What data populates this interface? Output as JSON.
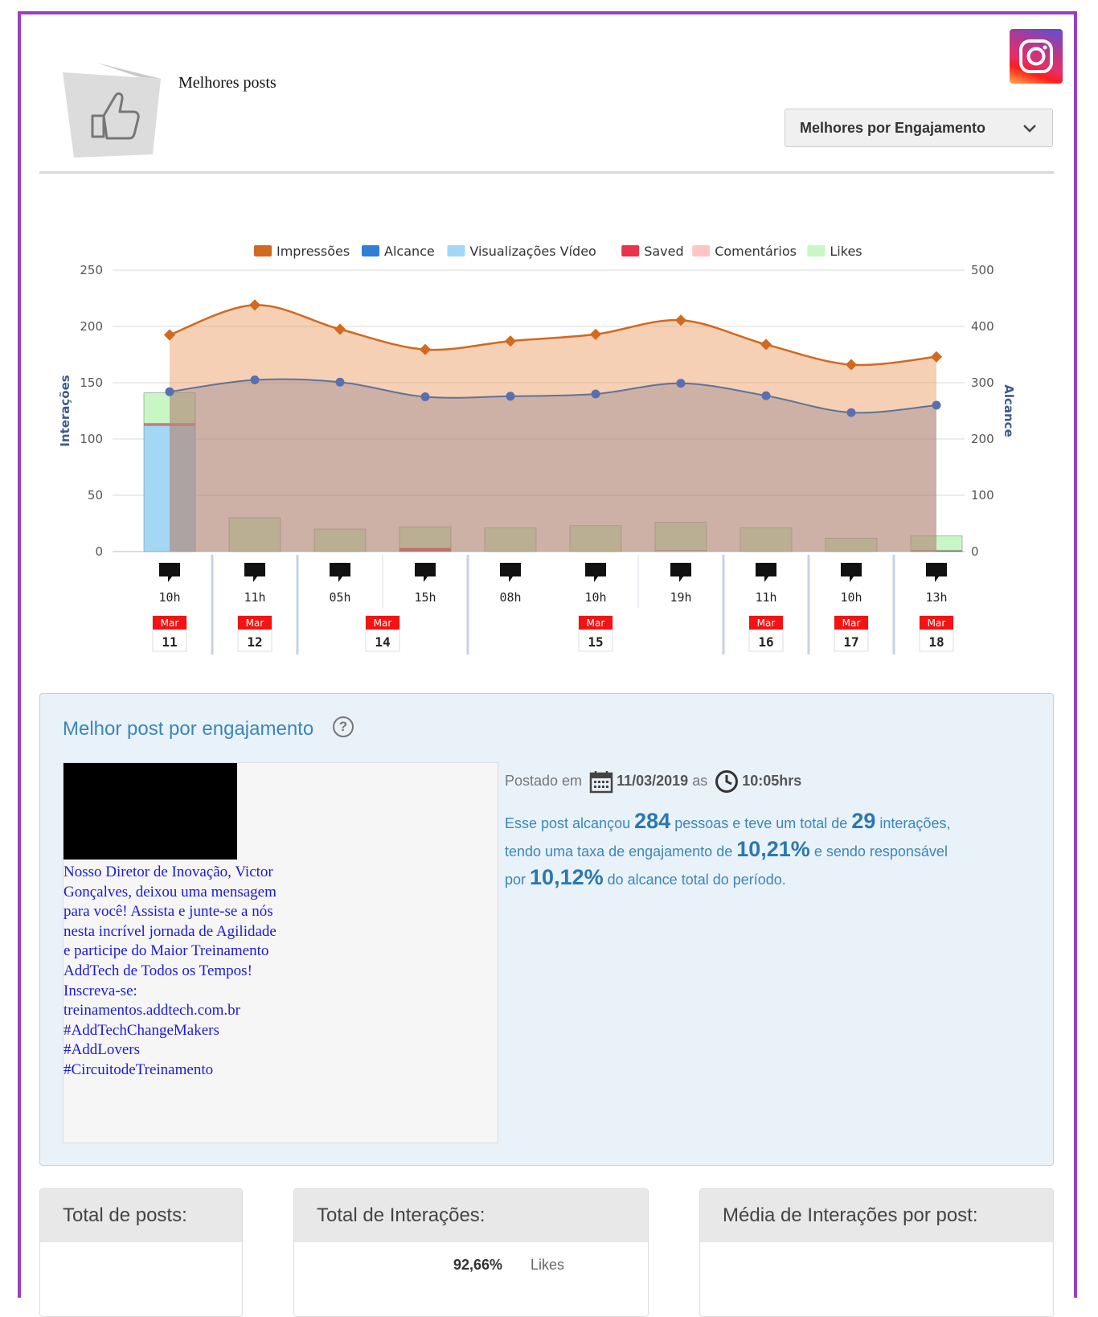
{
  "header": {
    "title": "Melhores posts"
  },
  "dropdown": {
    "selected": "Melhores por Engajamento"
  },
  "chart_data": {
    "type": "bar",
    "legend": [
      {
        "name": "Impressões",
        "color": "#d2691e"
      },
      {
        "name": "Alcance",
        "color": "#2f7ed8"
      },
      {
        "name": "Visualizações Vídeo",
        "color": "#a3d8f4"
      },
      {
        "name": "Saved",
        "color": "#e8334a"
      },
      {
        "name": "Comentários",
        "color": "#ffc5c5"
      },
      {
        "name": "Likes",
        "color": "#c8f7c5"
      }
    ],
    "y_left": {
      "label": "Interações",
      "ticks": [
        "0",
        "50",
        "100",
        "150",
        "200",
        "250"
      ],
      "ylim": [
        0,
        250
      ]
    },
    "y_right": {
      "label": "Alcance",
      "ticks": [
        "0",
        "100",
        "200",
        "300",
        "400",
        "500"
      ],
      "ylim": [
        0,
        500
      ]
    },
    "x_time_labels": [
      "10h",
      "11h",
      "05h",
      "15h",
      "08h",
      "10h",
      "19h",
      "11h",
      "10h",
      "13h"
    ],
    "date_badges": [
      {
        "month": "Mar",
        "day": "11",
        "slot": 0
      },
      {
        "month": "Mar",
        "day": "12",
        "slot": 1
      },
      {
        "month": "Mar",
        "day": "14",
        "slot": 2.5
      },
      {
        "month": "Mar",
        "day": "15",
        "slot": 5
      },
      {
        "month": "Mar",
        "day": "16",
        "slot": 7
      },
      {
        "month": "Mar",
        "day": "17",
        "slot": 8
      },
      {
        "month": "Mar",
        "day": "18",
        "slot": 9
      }
    ],
    "series": [
      {
        "name": "Impressões",
        "axis": "right",
        "values": [
          385,
          438,
          395,
          359,
          374,
          386,
          411,
          368,
          332,
          346
        ]
      },
      {
        "name": "Alcance",
        "axis": "right",
        "values": [
          284,
          305,
          301,
          275,
          276,
          280,
          299,
          277,
          247,
          260
        ]
      },
      {
        "name": "Visualizações Vídeo",
        "axis": "left",
        "values": [
          112,
          0,
          0,
          0,
          0,
          0,
          0,
          0,
          0,
          0
        ]
      },
      {
        "name": "Saved",
        "axis": "left",
        "values": [
          1,
          0,
          0,
          3,
          0,
          0,
          0,
          0,
          0,
          1
        ]
      },
      {
        "name": "Comentários",
        "axis": "left",
        "values": [
          1,
          0,
          0,
          0,
          0,
          0,
          1,
          0,
          0,
          0
        ]
      },
      {
        "name": "Likes",
        "axis": "left",
        "values": [
          27,
          30,
          20,
          19,
          21,
          23,
          25,
          21,
          12,
          13
        ]
      }
    ]
  },
  "best": {
    "title": "Melhor post por engajamento",
    "help": "?",
    "caption": "Nosso Diretor de Inovação, Victor Gonçalves, deixou uma mensagem para você! Assista e junte-se a nós nesta incrível jornada de Agilidade e participe do Maior Treinamento AddTech de Todos os Tempos! Inscreva-se: treinamentos.addtech.com.br #AddTechChangeMakers #AddLovers #CircuitodeTreinamento",
    "posted_label": "Postado em",
    "date": "11/03/2019",
    "as_label": "as",
    "time": "10:05hrs",
    "s1": "Esse post alcançou",
    "reach": "284",
    "s2": "pessoas e teve um total de",
    "interactions": "29",
    "s3": "interações,",
    "s4": "tendo uma taxa de engajamento de",
    "engagement": "10,21%",
    "s5": "e sendo responsável",
    "s6": "por",
    "share": "10,12%",
    "s7": "do alcance total do período."
  },
  "cards": {
    "posts_title": "Total de posts:",
    "interactions_title": "Total de Interações:",
    "avg_title": "Média de Interações por post:",
    "row1_pct": "92,66%",
    "row1_label": "Likes"
  }
}
